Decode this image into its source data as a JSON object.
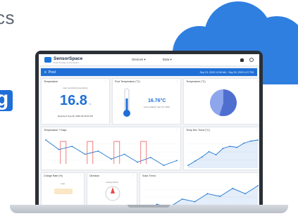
{
  "hero": {
    "text": "cs",
    "badge": "g"
  },
  "app": {
    "logo_name": "SensorSpace",
    "logo_tagline": "Data Storage and Analytics",
    "nav": [
      "Devices ▾",
      "Data ▾"
    ],
    "page_title": "Pool",
    "date_range": "Sep 23, 2020 12:00 AM - Sep 25, 2020 4:27 PM"
  },
  "cards": {
    "temperature": {
      "title": "Temperature",
      "sub": "Last recorded temperature",
      "value": "16.8",
      "unit": "°C",
      "reported": "Reported: Sep 25, 2020 02:19:01 PM"
    },
    "pool_temp": {
      "title": "Pool Temperature (°C)",
      "value": "16.76°C",
      "updated": "Last updated: Sep 25, 2020"
    },
    "pie": {
      "title": "Temperature (°C)"
    },
    "temp7": {
      "title": "Temperature 7 Days"
    },
    "temp_trend": {
      "title": "Temp Dev Trend (°C)"
    },
    "charge": {
      "title": "Charge Rate (%)",
      "sub": "Last"
    },
    "direction": {
      "title": "Direction",
      "sub": "Facing North"
    },
    "solar": {
      "title": "Solar Trend"
    }
  },
  "colors": {
    "accent": "#1f6fd6",
    "cloud": "#2f7fe0",
    "line": "#1f78d1",
    "red": "#e84a4a"
  },
  "chart_data": [
    {
      "type": "line",
      "title": "Temperature 7 Days",
      "series": [
        {
          "name": "",
          "values": [
            17.8,
            17.2,
            17.4,
            16.9,
            17.1,
            16.6,
            16.9,
            16.4,
            16.7,
            16.2,
            16.5
          ]
        }
      ]
    },
    {
      "type": "line",
      "title": "Temp Dev Trend (°C)",
      "series": [
        {
          "name": "",
          "values": [
            15.2,
            15.6,
            16.0,
            16.5,
            16.2,
            16.8,
            17.0,
            16.9,
            17.3,
            17.5,
            17.6
          ]
        }
      ]
    },
    {
      "type": "pie",
      "title": "Temperature (°C)",
      "series": [
        {
          "name": "",
          "values": [
            55,
            45
          ]
        }
      ]
    },
    {
      "type": "line",
      "title": "Solar Trend",
      "series": [
        {
          "name": "",
          "values": [
            2,
            3,
            2.5,
            4,
            3.5,
            5,
            4.5,
            6,
            5,
            6.5
          ]
        }
      ]
    }
  ]
}
